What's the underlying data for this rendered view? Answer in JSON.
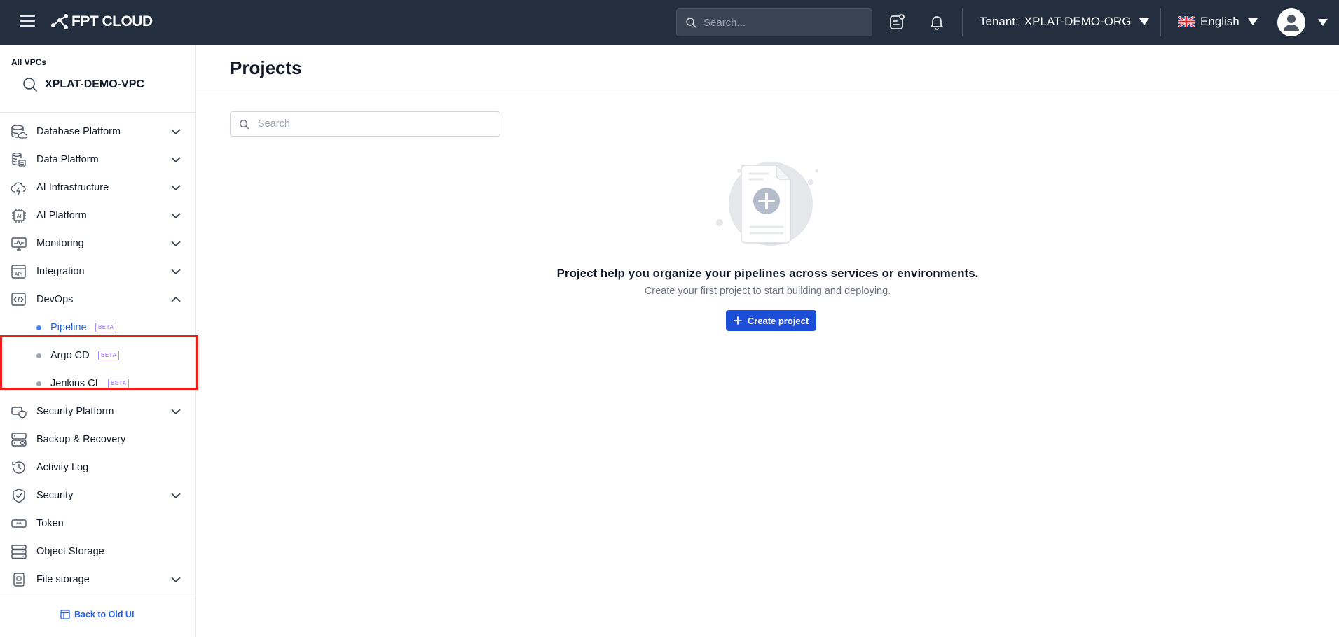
{
  "header": {
    "brand": "FPT CLOUD",
    "search_placeholder": "Search...",
    "tenant_label": "Tenant:",
    "tenant_value": "XPLAT-DEMO-ORG",
    "language": "English"
  },
  "sidebar": {
    "vpc_label": "All VPCs",
    "vpc_name": "XPLAT-DEMO-VPC",
    "items": [
      {
        "label": "Database Platform",
        "icon": "database-cloud-icon",
        "expandable": true
      },
      {
        "label": "Data Platform",
        "icon": "data-stack-icon",
        "expandable": true
      },
      {
        "label": "AI Infrastructure",
        "icon": "cloud-bolt-icon",
        "expandable": true
      },
      {
        "label": "AI Platform",
        "icon": "ai-chip-icon",
        "expandable": true
      },
      {
        "label": "Monitoring",
        "icon": "monitor-chart-icon",
        "expandable": true
      },
      {
        "label": "Integration",
        "icon": "api-icon",
        "expandable": true
      },
      {
        "label": "DevOps",
        "icon": "code-window-icon",
        "expandable": true,
        "expanded": true
      },
      {
        "label": "Security Platform",
        "icon": "shield-cloud-icon",
        "expandable": true
      },
      {
        "label": "Backup & Recovery",
        "icon": "backup-server-icon",
        "expandable": false
      },
      {
        "label": "Activity Log",
        "icon": "clock-history-icon",
        "expandable": false
      },
      {
        "label": "Security",
        "icon": "shield-check-icon",
        "expandable": true
      },
      {
        "label": "Token",
        "icon": "token-key-icon",
        "expandable": false
      },
      {
        "label": "Object Storage",
        "icon": "storage-server-icon",
        "expandable": false
      },
      {
        "label": "File storage",
        "icon": "file-storage-icon",
        "expandable": true
      }
    ],
    "devops_children": [
      {
        "label": "Pipeline",
        "badge": "BETA",
        "active": true
      },
      {
        "label": "Argo CD",
        "badge": "BETA",
        "active": false
      },
      {
        "label": "Jenkins CI",
        "badge": "BETA",
        "active": false
      }
    ],
    "back_old_ui": "Back to Old UI"
  },
  "main": {
    "title": "Projects",
    "search_placeholder": "Search",
    "empty_title": "Project help you organize your pipelines across services or environments.",
    "empty_subtitle": "Create your first project to start building and deploying.",
    "create_button": "Create project"
  },
  "colors": {
    "topbar_bg": "#232f3e",
    "primary": "#1d4ed8",
    "active_link": "#2563eb",
    "beta_badge": "#8b5cf6",
    "highlight": "#ef1c1c"
  }
}
